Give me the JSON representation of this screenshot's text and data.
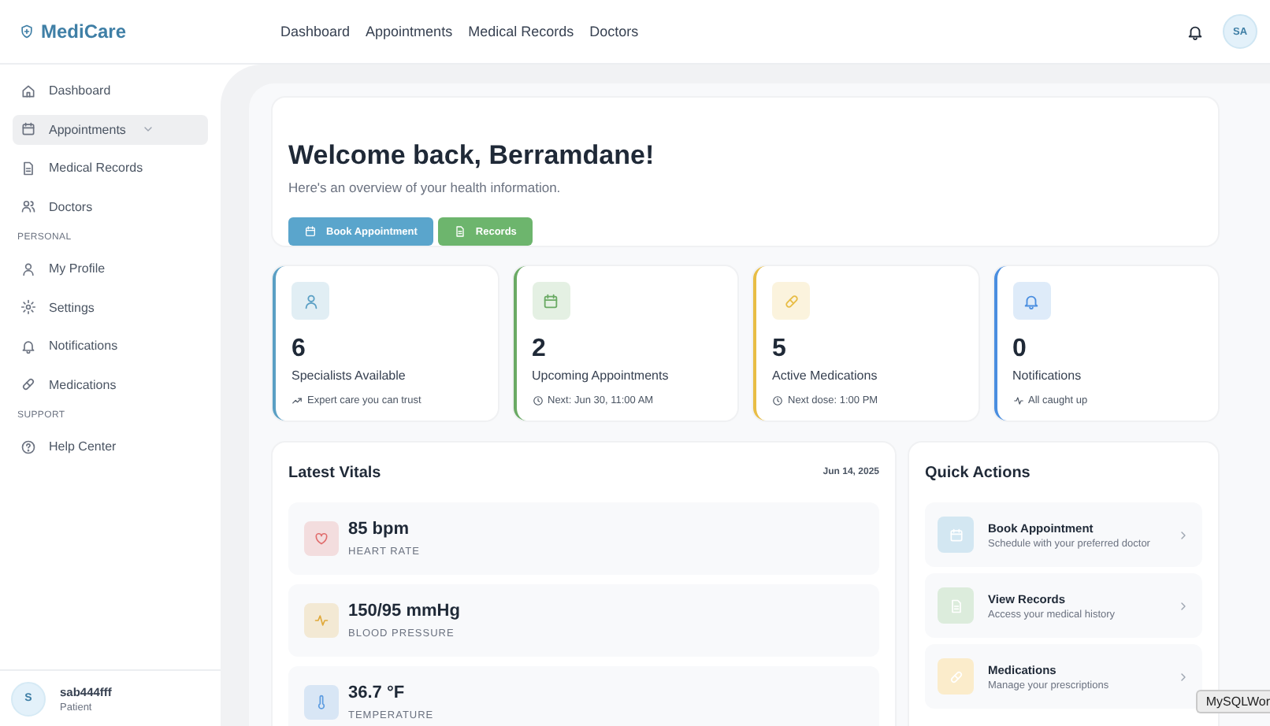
{
  "header": {
    "logo": "MediCare",
    "nav": [
      {
        "label": "Dashboard"
      },
      {
        "label": "Appointments"
      },
      {
        "label": "Medical Records"
      },
      {
        "label": "Doctors"
      }
    ],
    "avatar": "SA"
  },
  "sidebar": {
    "items": [
      {
        "kind": "link",
        "label": "Dashboard",
        "selected": false
      },
      {
        "kind": "group",
        "label": "Appointments",
        "selected": true
      },
      {
        "kind": "link",
        "label": "Medical Records",
        "selected": false
      },
      {
        "kind": "link",
        "label": "Doctors",
        "selected": false
      },
      {
        "kind": "heading",
        "label": "PERSONAL"
      },
      {
        "kind": "link",
        "label": "My Profile",
        "selected": false
      },
      {
        "kind": "link",
        "label": "Settings",
        "selected": false
      },
      {
        "kind": "link",
        "label": "Notifications",
        "selected": false
      },
      {
        "kind": "link",
        "label": "Medications",
        "selected": false
      },
      {
        "kind": "heading",
        "label": "SUPPORT"
      },
      {
        "kind": "link",
        "label": "Help Center",
        "selected": false
      }
    ],
    "user": {
      "initial": "S",
      "name": "sab444fff",
      "role": "Patient"
    }
  },
  "welcome": {
    "title": "Welcome back, Berramdane!",
    "subtitle": "Here's an overview of your health information.",
    "buttons": [
      {
        "label": "Book Appointment",
        "color": "#5aa5cc"
      },
      {
        "label": "Records",
        "color": "#6db56d"
      }
    ]
  },
  "stats": [
    {
      "value": "6",
      "label": "Specialists Available",
      "note": "Expert care you can trust",
      "color": "#5a9fc4"
    },
    {
      "value": "2",
      "label": "Upcoming Appointments",
      "note": "Next: Jun 30, 11:00 AM",
      "color": "#6aaa64"
    },
    {
      "value": "5",
      "label": "Active Medications",
      "note": "Next dose: 1:00 PM",
      "color": "#e8bd45"
    },
    {
      "value": "0",
      "label": "Notifications",
      "note": "All caught up",
      "color": "#4a8ee0"
    }
  ],
  "vitals": {
    "title": "Latest Vitals",
    "date": "Jun 14, 2025",
    "items": [
      {
        "value": "85 bpm",
        "label": "HEART RATE",
        "color": "#e06c6c"
      },
      {
        "value": "150/95 mmHg",
        "label": "BLOOD PRESSURE",
        "color": "#e0a93a"
      },
      {
        "value": "36.7 °F",
        "label": "TEMPERATURE",
        "color": "#5b9be0"
      }
    ]
  },
  "quick_actions": {
    "title": "Quick Actions",
    "items": [
      {
        "title": "Book Appointment",
        "subtitle": "Schedule with your preferred doctor",
        "color": "#d3e7f2"
      },
      {
        "title": "View Records",
        "subtitle": "Access your medical history",
        "color": "#dcecdc"
      },
      {
        "title": "Medications",
        "subtitle": "Manage your prescriptions",
        "color": "#fbeccb"
      }
    ]
  },
  "tooltip": "MySQLWor"
}
